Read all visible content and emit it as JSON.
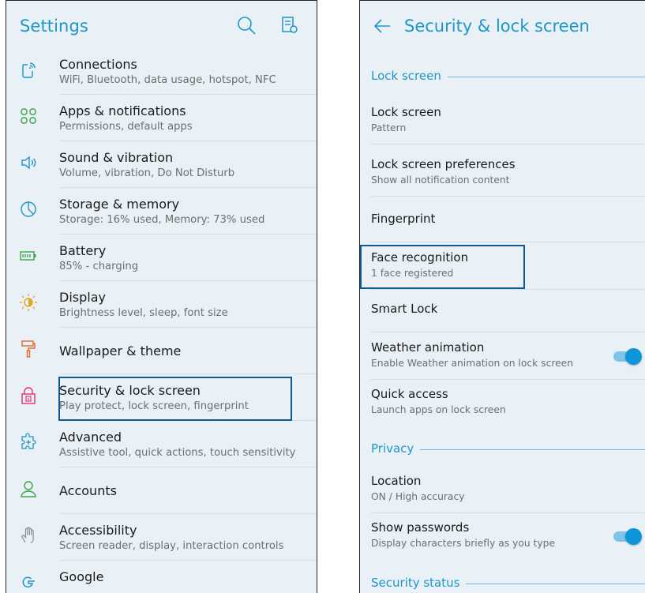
{
  "colors": {
    "accent": "#1d96c9",
    "highlight": "#0d5a93",
    "toggle_on": "#0c95d8",
    "screen_bg": "#e9f1f6"
  },
  "left": {
    "title": "Settings",
    "header_icons": [
      "search-icon",
      "settings-list-icon"
    ],
    "items": [
      {
        "icon": "connections-icon",
        "title": "Connections",
        "subtitle": "WiFi, Bluetooth, data usage, hotspot, NFC"
      },
      {
        "icon": "apps-grid-icon",
        "title": "Apps & notifications",
        "subtitle": "Permissions, default apps"
      },
      {
        "icon": "speaker-icon",
        "title": "Sound & vibration",
        "subtitle": "Volume, vibration, Do Not Disturb"
      },
      {
        "icon": "pie-chart-icon",
        "title": "Storage & memory",
        "subtitle": "Storage: 16% used, Memory: 73% used"
      },
      {
        "icon": "battery-icon",
        "title": "Battery",
        "subtitle": "85% - charging"
      },
      {
        "icon": "brightness-icon",
        "title": "Display",
        "subtitle": "Brightness level, sleep, font size"
      },
      {
        "icon": "paint-roller-icon",
        "title": "Wallpaper & theme",
        "subtitle": ""
      },
      {
        "icon": "lock-icon",
        "title": "Security & lock screen",
        "subtitle": "Play protect, lock screen, fingerprint"
      },
      {
        "icon": "puzzle-icon",
        "title": "Advanced",
        "subtitle": "Assistive tool, quick actions, touch sensitivity"
      },
      {
        "icon": "person-icon",
        "title": "Accounts",
        "subtitle": ""
      },
      {
        "icon": "hand-icon",
        "title": "Accessibility",
        "subtitle": "Screen reader, display, interaction controls"
      },
      {
        "icon": "google-icon",
        "title": "Google",
        "subtitle": ""
      }
    ]
  },
  "right": {
    "title": "Security & lock screen",
    "sections": {
      "lock_screen": "Lock screen",
      "privacy": "Privacy",
      "security_status": "Security status"
    },
    "items": [
      {
        "title": "Lock screen",
        "subtitle": "Pattern"
      },
      {
        "title": "Lock screen preferences",
        "subtitle": "Show all notification content"
      },
      {
        "title": "Fingerprint",
        "subtitle": ""
      },
      {
        "title": "Face recognition",
        "subtitle": "1 face registered"
      },
      {
        "title": "Smart Lock",
        "subtitle": ""
      },
      {
        "title": "Weather animation",
        "subtitle": "Enable Weather animation on lock screen",
        "toggle": true
      },
      {
        "title": "Quick access",
        "subtitle": "Launch apps on lock screen"
      },
      {
        "title": "Location",
        "subtitle": "ON / High accuracy"
      },
      {
        "title": "Show passwords",
        "subtitle": "Display characters briefly as you type",
        "toggle": true
      }
    ]
  }
}
